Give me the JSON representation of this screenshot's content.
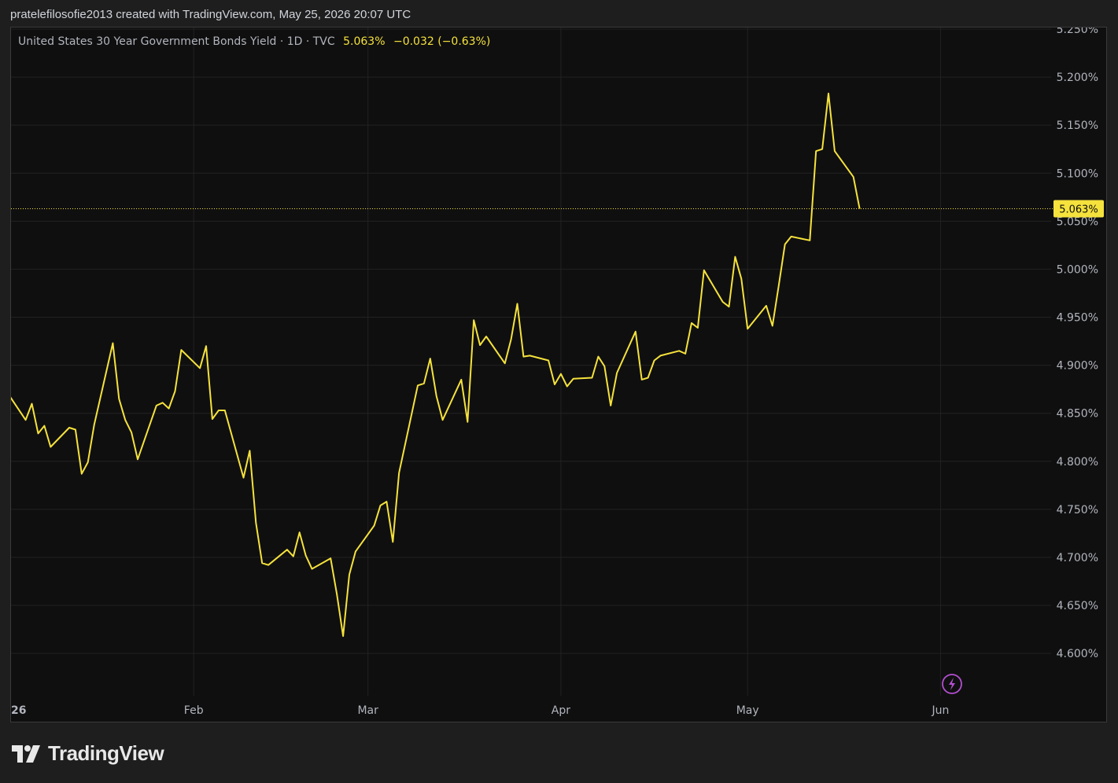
{
  "header": {
    "caption": "pratelefilosofie2013 created with TradingView.com, May 25, 2026 20:07 UTC"
  },
  "legend": {
    "symbol": "United States 30 Year Government Bonds Yield · 1D · TVC",
    "last": "5.063%",
    "change": "−0.032 (−0.63%)"
  },
  "footer": {
    "brand": "TradingView"
  },
  "colors": {
    "background": "#1e1e1e",
    "plot_bg": "#0f0f0f",
    "line": "#f5e23c",
    "grid": "#222222",
    "text": "#b2b5be",
    "badge_bg": "#f5e23c",
    "badge_text": "#0f0f0f",
    "bolt_icon": "#b44fd3"
  },
  "chart_data": {
    "type": "line",
    "title": "United States 30 Year Government Bonds Yield",
    "x": [
      "2026-01-02",
      "2026-01-05",
      "2026-01-06",
      "2026-01-07",
      "2026-01-08",
      "2026-01-09",
      "2026-01-12",
      "2026-01-13",
      "2026-01-14",
      "2026-01-15",
      "2026-01-16",
      "2026-01-19",
      "2026-01-20",
      "2026-01-21",
      "2026-01-22",
      "2026-01-23",
      "2026-01-26",
      "2026-01-27",
      "2026-01-28",
      "2026-01-29",
      "2026-01-30",
      "2026-02-02",
      "2026-02-03",
      "2026-02-04",
      "2026-02-05",
      "2026-02-06",
      "2026-02-09",
      "2026-02-10",
      "2026-02-11",
      "2026-02-12",
      "2026-02-13",
      "2026-02-16",
      "2026-02-17",
      "2026-02-18",
      "2026-02-19",
      "2026-02-20",
      "2026-02-23",
      "2026-02-24",
      "2026-02-25",
      "2026-02-26",
      "2026-02-27",
      "2026-03-02",
      "2026-03-03",
      "2026-03-04",
      "2026-03-05",
      "2026-03-06",
      "2026-03-09",
      "2026-03-10",
      "2026-03-11",
      "2026-03-12",
      "2026-03-13",
      "2026-03-16",
      "2026-03-17",
      "2026-03-18",
      "2026-03-19",
      "2026-03-20",
      "2026-03-23",
      "2026-03-24",
      "2026-03-25",
      "2026-03-26",
      "2026-03-27",
      "2026-03-30",
      "2026-03-31",
      "2026-04-01",
      "2026-04-02",
      "2026-04-03",
      "2026-04-06",
      "2026-04-07",
      "2026-04-08",
      "2026-04-09",
      "2026-04-10",
      "2026-04-13",
      "2026-04-14",
      "2026-04-15",
      "2026-04-16",
      "2026-04-17",
      "2026-04-20",
      "2026-04-21",
      "2026-04-22",
      "2026-04-23",
      "2026-04-24",
      "2026-04-27",
      "2026-04-28",
      "2026-04-29",
      "2026-04-30",
      "2026-05-01",
      "2026-05-04",
      "2026-05-05",
      "2026-05-06",
      "2026-05-07",
      "2026-05-08",
      "2026-05-11",
      "2026-05-12",
      "2026-05-13",
      "2026-05-14",
      "2026-05-15",
      "2026-05-18",
      "2026-05-19",
      "2026-05-20",
      "2026-05-21",
      "2026-05-22"
    ],
    "series": [
      {
        "values": [
          4.872,
          4.843,
          4.86,
          4.829,
          4.837,
          4.815,
          4.835,
          4.833,
          4.787,
          4.799,
          4.838,
          4.923,
          4.865,
          4.843,
          4.83,
          4.802,
          4.858,
          4.861,
          4.855,
          4.873,
          4.916,
          4.897,
          4.92,
          4.844,
          4.853,
          4.853,
          4.783,
          4.811,
          4.736,
          4.694,
          4.692,
          4.708,
          4.701,
          4.726,
          4.702,
          4.688,
          4.699,
          4.662,
          4.618,
          4.682,
          4.706,
          4.733,
          4.754,
          4.758,
          4.716,
          4.788,
          4.879,
          4.881,
          4.907,
          4.868,
          4.843,
          4.885,
          4.841,
          4.947,
          4.921,
          4.93,
          4.902,
          4.927,
          4.964,
          4.909,
          4.91,
          4.905,
          4.88,
          4.891,
          4.878,
          4.886,
          4.887,
          4.909,
          4.899,
          4.858,
          4.892,
          4.935,
          4.885,
          4.887,
          4.905,
          4.91,
          4.915,
          4.912,
          4.944,
          4.939,
          4.999,
          4.966,
          4.961,
          5.013,
          4.99,
          4.938,
          4.962,
          4.941,
          4.983,
          5.026,
          5.034,
          5.03,
          5.123,
          5.125,
          5.183,
          5.123,
          5.096,
          5.063
        ]
      }
    ],
    "x_ticks": [
      "26",
      "Feb",
      "Mar",
      "Apr",
      "May",
      "Jun"
    ],
    "y_ticks": [
      "4.600%",
      "4.650%",
      "4.700%",
      "4.750%",
      "4.800%",
      "4.850%",
      "4.900%",
      "4.950%",
      "5.000%",
      "5.050%",
      "5.100%",
      "5.150%",
      "5.200%",
      "5.250%"
    ],
    "ylim": [
      4.56,
      5.25
    ],
    "last_value_label": "5.063%",
    "grid": true,
    "y_axis_side": "right"
  }
}
